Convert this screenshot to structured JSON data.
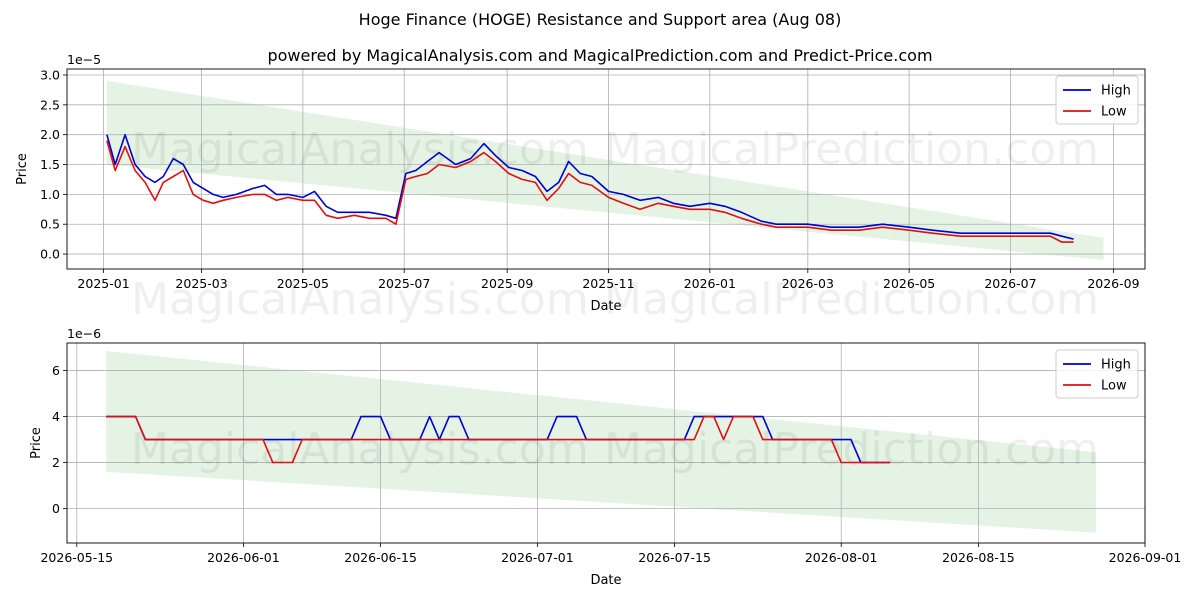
{
  "title": "Hoge Finance (HOGE) Resistance and Support area (Aug 08)",
  "subtitle": "powered by MagicalAnalysis.com and MagicalPrediction.com and Predict-Price.com",
  "watermarks": [
    "MagicalAnalysis.com",
    "MagicalPrediction.com"
  ],
  "colors": {
    "high": "#0000cc",
    "low": "#dd1111",
    "band": "#2ca02c"
  },
  "chart_data": [
    {
      "type": "line",
      "xlabel": "Date",
      "ylabel": "Price",
      "offset_label": "1e−5",
      "x_ticks": [
        "2025-01",
        "2025-03",
        "2025-05",
        "2025-07",
        "2025-09",
        "2025-11",
        "2026-01",
        "2026-03",
        "2026-05",
        "2026-07",
        "2026-09"
      ],
      "x_tick_values": [
        "2025-01-01",
        "2025-03-01",
        "2025-05-01",
        "2025-07-01",
        "2025-09-01",
        "2025-11-01",
        "2026-01-01",
        "2026-03-01",
        "2026-05-01",
        "2026-07-01",
        "2026-09-01"
      ],
      "y_ticks": [
        "0.0",
        "0.5",
        "1.0",
        "1.5",
        "2.0",
        "2.5",
        "3.0"
      ],
      "y_tick_values": [
        0.0,
        0.5,
        1.0,
        1.5,
        2.0,
        2.5,
        3.0
      ],
      "xlim": [
        "2024-12-10",
        "2026-09-20"
      ],
      "ylim": [
        -0.25,
        3.1
      ],
      "grid": true,
      "legend": "top-right",
      "band": {
        "x": [
          "2025-01-03",
          "2026-08-26"
        ],
        "upper": [
          2.9,
          0.27
        ],
        "lower": [
          1.5,
          -0.1
        ]
      },
      "series": [
        {
          "name": "High",
          "x": [
            "2025-01-03",
            "2025-01-08",
            "2025-01-14",
            "2025-01-20",
            "2025-01-26",
            "2025-02-01",
            "2025-02-06",
            "2025-02-12",
            "2025-02-18",
            "2025-02-24",
            "2025-03-02",
            "2025-03-08",
            "2025-03-14",
            "2025-03-22",
            "2025-04-01",
            "2025-04-08",
            "2025-04-15",
            "2025-04-22",
            "2025-05-01",
            "2025-05-08",
            "2025-05-15",
            "2025-05-22",
            "2025-06-01",
            "2025-06-10",
            "2025-06-20",
            "2025-06-26",
            "2025-07-02",
            "2025-07-08",
            "2025-07-15",
            "2025-07-22",
            "2025-08-01",
            "2025-08-10",
            "2025-08-18",
            "2025-08-25",
            "2025-09-02",
            "2025-09-10",
            "2025-09-18",
            "2025-09-25",
            "2025-10-02",
            "2025-10-08",
            "2025-10-15",
            "2025-10-22",
            "2025-11-01",
            "2025-11-10",
            "2025-11-20",
            "2025-12-01",
            "2025-12-10",
            "2025-12-20",
            "2026-01-01",
            "2026-01-10",
            "2026-01-20",
            "2026-02-01",
            "2026-02-10",
            "2026-02-20",
            "2026-03-01",
            "2026-03-15",
            "2026-04-01",
            "2026-04-15",
            "2026-05-01",
            "2026-05-15",
            "2026-06-01",
            "2026-06-15",
            "2026-07-01",
            "2026-07-15",
            "2026-07-25",
            "2026-08-01",
            "2026-08-08"
          ],
          "values": [
            2.0,
            1.5,
            2.0,
            1.5,
            1.3,
            1.2,
            1.3,
            1.6,
            1.5,
            1.2,
            1.1,
            1.0,
            0.95,
            1.0,
            1.1,
            1.15,
            1.0,
            1.0,
            0.95,
            1.05,
            0.8,
            0.7,
            0.7,
            0.7,
            0.65,
            0.6,
            1.35,
            1.4,
            1.55,
            1.7,
            1.5,
            1.6,
            1.85,
            1.65,
            1.45,
            1.4,
            1.3,
            1.05,
            1.2,
            1.55,
            1.35,
            1.3,
            1.05,
            1.0,
            0.9,
            0.95,
            0.85,
            0.8,
            0.85,
            0.8,
            0.7,
            0.55,
            0.5,
            0.5,
            0.5,
            0.45,
            0.45,
            0.5,
            0.45,
            0.4,
            0.35,
            0.35,
            0.35,
            0.35,
            0.35,
            0.3,
            0.25
          ]
        },
        {
          "name": "Low",
          "x": [
            "2025-01-03",
            "2025-01-08",
            "2025-01-14",
            "2025-01-20",
            "2025-01-26",
            "2025-02-01",
            "2025-02-06",
            "2025-02-12",
            "2025-02-18",
            "2025-02-24",
            "2025-03-02",
            "2025-03-08",
            "2025-03-14",
            "2025-03-22",
            "2025-04-01",
            "2025-04-08",
            "2025-04-15",
            "2025-04-22",
            "2025-05-01",
            "2025-05-08",
            "2025-05-15",
            "2025-05-22",
            "2025-06-01",
            "2025-06-10",
            "2025-06-20",
            "2025-06-26",
            "2025-07-02",
            "2025-07-08",
            "2025-07-15",
            "2025-07-22",
            "2025-08-01",
            "2025-08-10",
            "2025-08-18",
            "2025-08-25",
            "2025-09-02",
            "2025-09-10",
            "2025-09-18",
            "2025-09-25",
            "2025-10-02",
            "2025-10-08",
            "2025-10-15",
            "2025-10-22",
            "2025-11-01",
            "2025-11-10",
            "2025-11-20",
            "2025-12-01",
            "2025-12-10",
            "2025-12-20",
            "2026-01-01",
            "2026-01-10",
            "2026-01-20",
            "2026-02-01",
            "2026-02-10",
            "2026-02-20",
            "2026-03-01",
            "2026-03-15",
            "2026-04-01",
            "2026-04-15",
            "2026-05-01",
            "2026-05-15",
            "2026-06-01",
            "2026-06-15",
            "2026-07-01",
            "2026-07-15",
            "2026-07-25",
            "2026-08-01",
            "2026-08-08"
          ],
          "values": [
            1.9,
            1.4,
            1.8,
            1.4,
            1.2,
            0.9,
            1.2,
            1.3,
            1.4,
            1.0,
            0.9,
            0.85,
            0.9,
            0.95,
            1.0,
            1.0,
            0.9,
            0.95,
            0.9,
            0.9,
            0.65,
            0.6,
            0.65,
            0.6,
            0.6,
            0.5,
            1.25,
            1.3,
            1.35,
            1.5,
            1.45,
            1.55,
            1.7,
            1.55,
            1.35,
            1.25,
            1.2,
            0.9,
            1.1,
            1.35,
            1.2,
            1.15,
            0.95,
            0.85,
            0.75,
            0.85,
            0.8,
            0.75,
            0.75,
            0.7,
            0.6,
            0.5,
            0.45,
            0.45,
            0.45,
            0.4,
            0.4,
            0.45,
            0.4,
            0.35,
            0.3,
            0.3,
            0.3,
            0.3,
            0.3,
            0.2,
            0.2
          ]
        }
      ]
    },
    {
      "type": "line",
      "xlabel": "Date",
      "ylabel": "Price",
      "offset_label": "1e−6",
      "x_ticks": [
        "2026-05-15",
        "2026-06-01",
        "2026-06-15",
        "2026-07-01",
        "2026-07-15",
        "2026-08-01",
        "2026-08-15",
        "2026-09-01"
      ],
      "x_tick_values": [
        "2026-05-15",
        "2026-06-01",
        "2026-06-15",
        "2026-07-01",
        "2026-07-15",
        "2026-08-01",
        "2026-08-15",
        "2026-09-01"
      ],
      "y_ticks": [
        "0",
        "2",
        "4",
        "6"
      ],
      "y_tick_values": [
        0,
        2,
        4,
        6
      ],
      "xlim": [
        "2026-05-14",
        "2026-09-01"
      ],
      "ylim": [
        -1.5,
        7.2
      ],
      "grid": true,
      "legend": "top-right",
      "band": {
        "x": [
          "2026-05-18",
          "2026-08-27"
        ],
        "upper": [
          6.85,
          2.45
        ],
        "lower": [
          1.6,
          -1.05
        ]
      },
      "series": [
        {
          "name": "High",
          "x": [
            "2026-05-18",
            "2026-05-21",
            "2026-05-22",
            "2026-06-12",
            "2026-06-13",
            "2026-06-15",
            "2026-06-16",
            "2026-06-19",
            "2026-06-20",
            "2026-06-21",
            "2026-06-22",
            "2026-06-23",
            "2026-06-24",
            "2026-07-02",
            "2026-07-03",
            "2026-07-05",
            "2026-07-06",
            "2026-07-16",
            "2026-07-17",
            "2026-07-24",
            "2026-07-25",
            "2026-08-02",
            "2026-08-03",
            "2026-08-06"
          ],
          "values": [
            4,
            4,
            3,
            3,
            4,
            4,
            3,
            3,
            4,
            3,
            4,
            4,
            3,
            3,
            4,
            4,
            3,
            3,
            4,
            4,
            3,
            3,
            2,
            2
          ]
        },
        {
          "name": "Low",
          "x": [
            "2026-05-18",
            "2026-05-21",
            "2026-05-22",
            "2026-06-03",
            "2026-06-04",
            "2026-06-06",
            "2026-06-07",
            "2026-07-17",
            "2026-07-18",
            "2026-07-19",
            "2026-07-20",
            "2026-07-21",
            "2026-07-23",
            "2026-07-24",
            "2026-07-31",
            "2026-08-01",
            "2026-08-06"
          ],
          "values": [
            4,
            4,
            3,
            3,
            2,
            2,
            3,
            3,
            4,
            4,
            3,
            4,
            4,
            3,
            3,
            2,
            2
          ]
        }
      ]
    }
  ]
}
